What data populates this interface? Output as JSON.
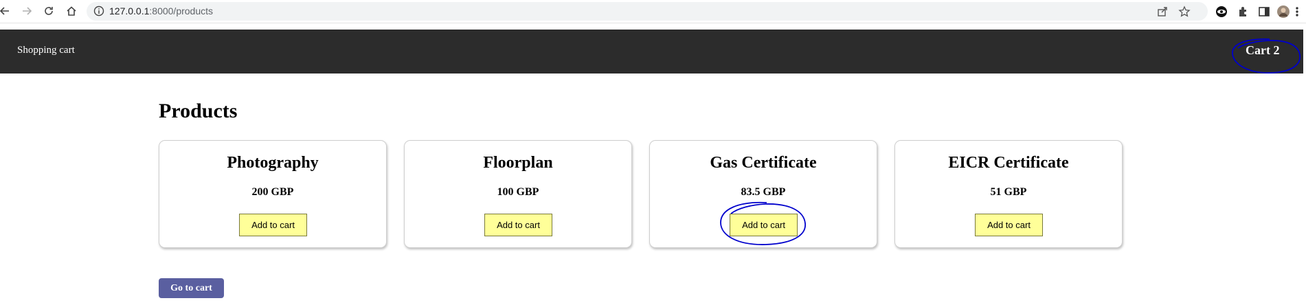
{
  "browser": {
    "url_host": "127.0.0.1",
    "url_path": ":8000/products"
  },
  "navbar": {
    "brand": "Shopping cart",
    "cart_label": "Cart 2"
  },
  "page": {
    "title": "Products"
  },
  "products": [
    {
      "name": "Photography",
      "price": "200 GBP",
      "button": "Add to cart"
    },
    {
      "name": "Floorplan",
      "price": "100 GBP",
      "button": "Add to cart"
    },
    {
      "name": "Gas Certificate",
      "price": "83.5 GBP",
      "button": "Add to cart"
    },
    {
      "name": "EICR Certificate",
      "price": "51 GBP",
      "button": "Add to cart"
    }
  ],
  "footer": {
    "go_to_cart": "Go to cart"
  },
  "colors": {
    "navbar_bg": "#2c2c2c",
    "add_button_bg": "#ffff99",
    "go_cart_bg": "#5a5fa0",
    "annotation": "#0000cc"
  }
}
